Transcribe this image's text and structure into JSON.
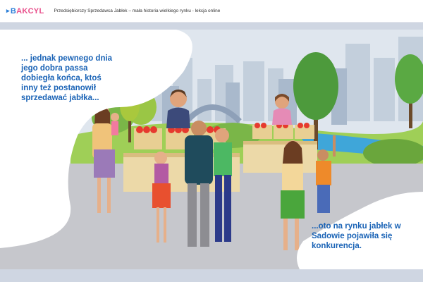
{
  "header": {
    "logo_text_b": "B",
    "logo_text_rest": "AKCYL",
    "lesson_title": "Przedsiębiorczy Sprzedawca Jabłek – mała historia wielkiego rynku - lekcja online"
  },
  "story": {
    "caption_left": "... jednak pewnego dnia jego dobra passa dobiegła końca, ktoś inny też postanowił sprzedawać jabłka...",
    "caption_right": "...oto na rynku jabłek w Sadowie pojawiła się konkurencja."
  },
  "colors": {
    "caption_text": "#1a63b6",
    "logo_blue": "#2b7fd8",
    "logo_pink": "#e84d8a",
    "sky": "#d9e1ea",
    "grass": "#8fc34a",
    "apple_red": "#e63a2e",
    "crate": "#ecd9a8"
  }
}
